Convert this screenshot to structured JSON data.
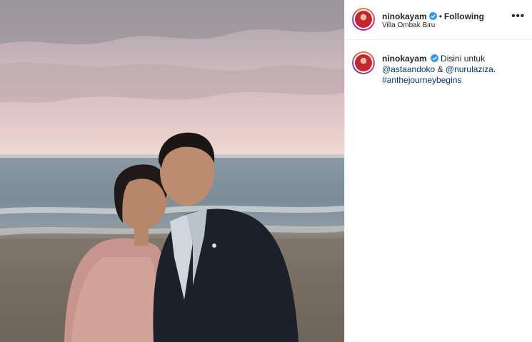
{
  "post": {
    "username": "ninokayam",
    "verified": true,
    "following_label": "Following",
    "location": "Villa Ombak Biru",
    "more_label": "•••",
    "caption": {
      "username": "ninokayam",
      "text_start": "Disini untuk",
      "mention_1": "@astaandoko",
      "connector": " & ",
      "mention_2": "@nurulaziza",
      "period": ".",
      "hashtag": "#anthejourneybegins"
    }
  },
  "colors": {
    "verified_blue": "#3897f0",
    "link": "#00376b",
    "text": "#262626"
  },
  "icons": {
    "avatar": "avatar-icon",
    "verified": "verified-badge-icon",
    "more": "more-options-icon"
  }
}
